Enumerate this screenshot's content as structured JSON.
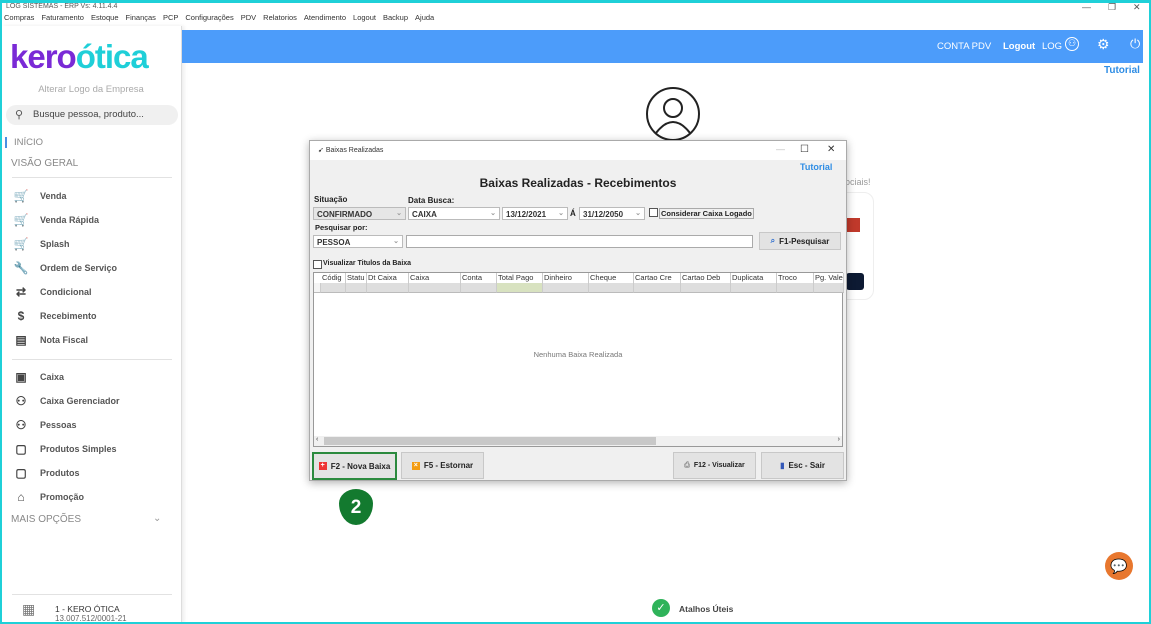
{
  "window": {
    "title": "LOG SISTEMAS - ERP Vs: 4.11.4.4"
  },
  "menu": [
    "Compras",
    "Faturamento",
    "Estoque",
    "Finanças",
    "PCP",
    "Configurações",
    "PDV",
    "Relatorios",
    "Atendimento",
    "Logout",
    "Backup",
    "Ajuda"
  ],
  "sidebar": {
    "logo": "keroótica",
    "alter_logo": "Alterar Logo da Empresa",
    "search_placeholder": "Busque pessoa, produto...",
    "inicio": "INÍCIO",
    "visao": "VISÃO GERAL",
    "group1": [
      {
        "label": "Venda",
        "icon": "cart-icon"
      },
      {
        "label": "Venda Rápida",
        "icon": "cart-icon"
      },
      {
        "label": "Splash",
        "icon": "cart-dollar-icon"
      },
      {
        "label": "Ordem de Serviço",
        "icon": "wrench-icon"
      },
      {
        "label": "Condicional",
        "icon": "cart-arrows-icon"
      },
      {
        "label": "Recebimento",
        "icon": "hand-dollar-icon"
      },
      {
        "label": "Nota Fiscal",
        "icon": "nfe-icon"
      }
    ],
    "group2": [
      {
        "label": "Caixa",
        "icon": "cash-register-icon"
      },
      {
        "label": "Caixa Gerenciador",
        "icon": "user-dollar-icon"
      },
      {
        "label": "Pessoas",
        "icon": "user-card-icon"
      },
      {
        "label": "Produtos Simples",
        "icon": "box-icon"
      },
      {
        "label": "Produtos",
        "icon": "box-icon"
      },
      {
        "label": "Promoção",
        "icon": "tag-icon"
      }
    ],
    "mais": "MAIS OPÇÕES",
    "company": "1 - KERO ÓTICA",
    "cnpj": "13.007.512/0001-21"
  },
  "header": {
    "conta": "CONTA PDV",
    "logout": "Logout",
    "log": "LOG",
    "tutorial": "Tutorial"
  },
  "background": {
    "sociais": "ociais!",
    "atalhos": "Atalhos Úteis"
  },
  "dialog": {
    "title": "Baixas Realizadas",
    "tutorial": "Tutorial",
    "heading": "Baixas Realizadas - Recebimentos",
    "situacao_label": "Situação",
    "situacao": "CONFIRMADO",
    "data_label": "Data Busca:",
    "data_tipo": "CAIXA",
    "date_from": "13/12/2021",
    "a": "Á",
    "date_to": "31/12/2050",
    "considerar": "Considerar Caixa Logado",
    "pesquisar_label": "Pesquisar por:",
    "pesquisar_tipo": "PESSOA",
    "search_value": "",
    "f1": "F1-Pesquisar",
    "visualizar": "Visualizar Titulos da Baixa",
    "columns": [
      "Códig",
      "Statu",
      "Dt Caixa",
      "Caixa",
      "Conta",
      "Total Pago",
      "Dinheiro",
      "Cheque",
      "Cartao Cre",
      "Cartao Deb",
      "Duplicata",
      "Troco",
      "Pg. Vale"
    ],
    "empty": "Nenhuma Baixa Realizada",
    "buttons": {
      "nova": "F2 - Nova Baixa",
      "estornar": "F5 - Estornar",
      "visualizar": "F12 - Visualizar",
      "sair": "Esc - Sair"
    }
  },
  "step_badge": "2",
  "colors": {
    "header": "#4c9cfa",
    "accent_cyan": "#1fd0d8",
    "logo_purple": "#7a2ad6",
    "badge_green": "#137a2f",
    "chat_orange": "#e8772e"
  }
}
